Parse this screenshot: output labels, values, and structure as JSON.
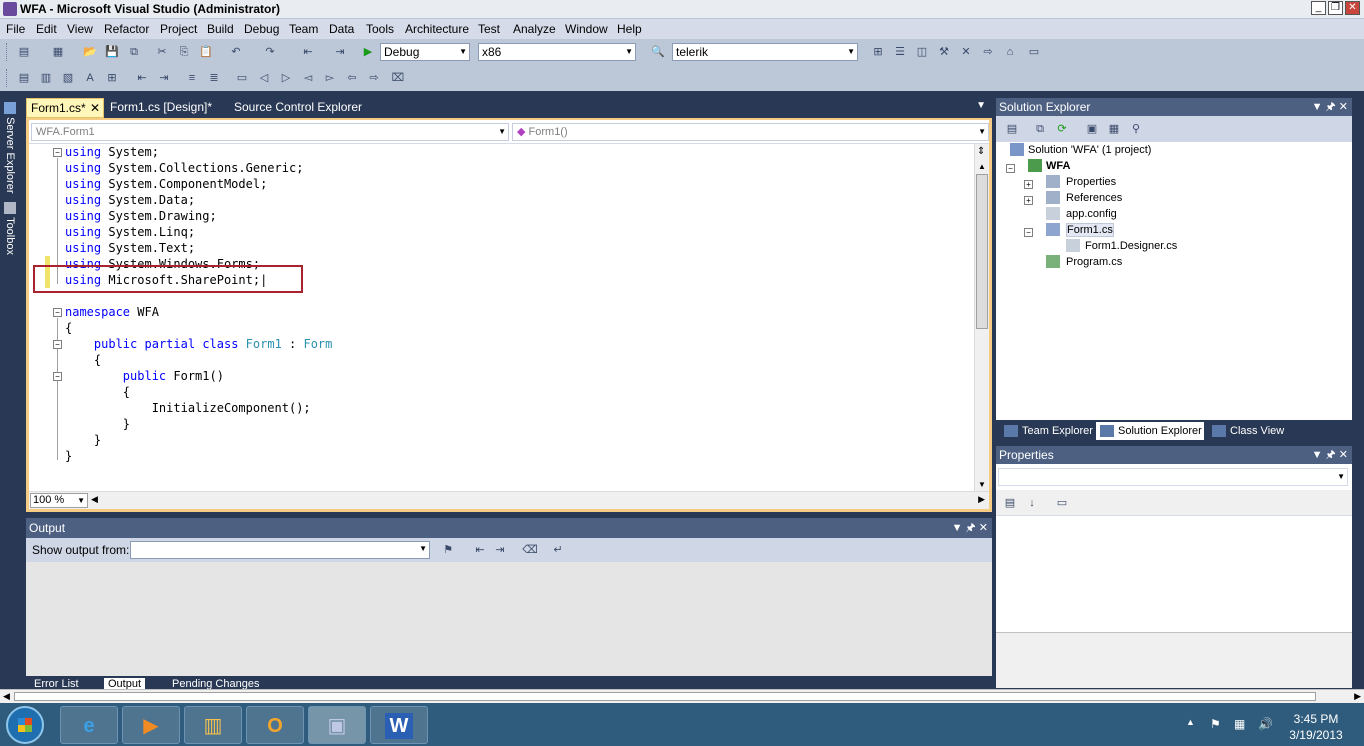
{
  "window": {
    "title": "WFA - Microsoft Visual Studio (Administrator)",
    "controls": {
      "minimize": "_",
      "restore": "❐",
      "close": "✕"
    }
  },
  "menu": [
    "File",
    "Edit",
    "View",
    "Refactor",
    "Project",
    "Build",
    "Debug",
    "Team",
    "Data",
    "Tools",
    "Architecture",
    "Test",
    "Analyze",
    "Window",
    "Help"
  ],
  "toolbar": {
    "config": "Debug",
    "platform": "x86",
    "find": "telerik"
  },
  "side_tabs": [
    "Server Explorer",
    "Toolbox"
  ],
  "doc_tabs": [
    {
      "label": "Form1.cs*",
      "active": true
    },
    {
      "label": "Form1.cs [Design]*",
      "active": false
    },
    {
      "label": "Source Control Explorer",
      "active": false
    }
  ],
  "navbar": {
    "type": "WFA.Form1",
    "member": "Form1()"
  },
  "code": [
    [
      {
        "t": "using",
        "k": "kw"
      },
      {
        "t": " System;"
      }
    ],
    [
      {
        "t": "using",
        "k": "kw"
      },
      {
        "t": " System.Collections.Generic;"
      }
    ],
    [
      {
        "t": "using",
        "k": "kw"
      },
      {
        "t": " System.ComponentModel;"
      }
    ],
    [
      {
        "t": "using",
        "k": "kw"
      },
      {
        "t": " System.Data;"
      }
    ],
    [
      {
        "t": "using",
        "k": "kw"
      },
      {
        "t": " System.Drawing;"
      }
    ],
    [
      {
        "t": "using",
        "k": "kw"
      },
      {
        "t": " System.Linq;"
      }
    ],
    [
      {
        "t": "using",
        "k": "kw"
      },
      {
        "t": " System.Text;"
      }
    ],
    [
      {
        "t": "using",
        "k": "kw"
      },
      {
        "t": " System.Windows.Forms;"
      }
    ],
    [
      {
        "t": "using",
        "k": "kw"
      },
      {
        "t": " Microsoft.SharePoint;|"
      }
    ],
    [],
    [
      {
        "t": "namespace",
        "k": "kw"
      },
      {
        "t": " WFA"
      }
    ],
    [
      {
        "t": "{"
      }
    ],
    [
      {
        "t": "    "
      },
      {
        "t": "public",
        "k": "kw"
      },
      {
        "t": " "
      },
      {
        "t": "partial",
        "k": "kw"
      },
      {
        "t": " "
      },
      {
        "t": "class",
        "k": "kw"
      },
      {
        "t": " "
      },
      {
        "t": "Form1",
        "k": "ty"
      },
      {
        "t": " : "
      },
      {
        "t": "Form",
        "k": "ty"
      }
    ],
    [
      {
        "t": "    {"
      }
    ],
    [
      {
        "t": "        "
      },
      {
        "t": "public",
        "k": "kw"
      },
      {
        "t": " Form1()"
      }
    ],
    [
      {
        "t": "        {"
      }
    ],
    [
      {
        "t": "            InitializeComponent();"
      }
    ],
    [
      {
        "t": "        }"
      }
    ],
    [
      {
        "t": "    }"
      }
    ],
    [
      {
        "t": "}"
      }
    ]
  ],
  "zoom": "100 %",
  "output": {
    "title": "Output",
    "show_from_label": "Show output from:",
    "source": ""
  },
  "bottom_tabs": [
    {
      "label": "Error List",
      "active": false
    },
    {
      "label": "Output",
      "active": true
    },
    {
      "label": "Pending Changes",
      "active": false
    }
  ],
  "solution_explorer": {
    "title": "Solution Explorer",
    "items": [
      {
        "label": "Solution 'WFA' (1 project)",
        "bold": false
      },
      {
        "label": "WFA",
        "bold": true
      },
      {
        "label": "Properties",
        "bold": false
      },
      {
        "label": "References",
        "bold": false
      },
      {
        "label": "app.config",
        "bold": false
      },
      {
        "label": "Form1.cs",
        "bold": false
      },
      {
        "label": "Form1.Designer.cs",
        "bold": false
      },
      {
        "label": "Program.cs",
        "bold": false
      }
    ]
  },
  "right_tabs": [
    {
      "label": "Team Explorer",
      "active": false
    },
    {
      "label": "Solution Explorer",
      "active": true
    },
    {
      "label": "Class View",
      "active": false
    }
  ],
  "properties": {
    "title": "Properties"
  },
  "taskbar": {
    "apps": [
      "internet-explorer",
      "media-player",
      "file-explorer",
      "outlook",
      "visual-studio",
      "word"
    ],
    "time": "3:45 PM",
    "date": "3/19/2013"
  }
}
